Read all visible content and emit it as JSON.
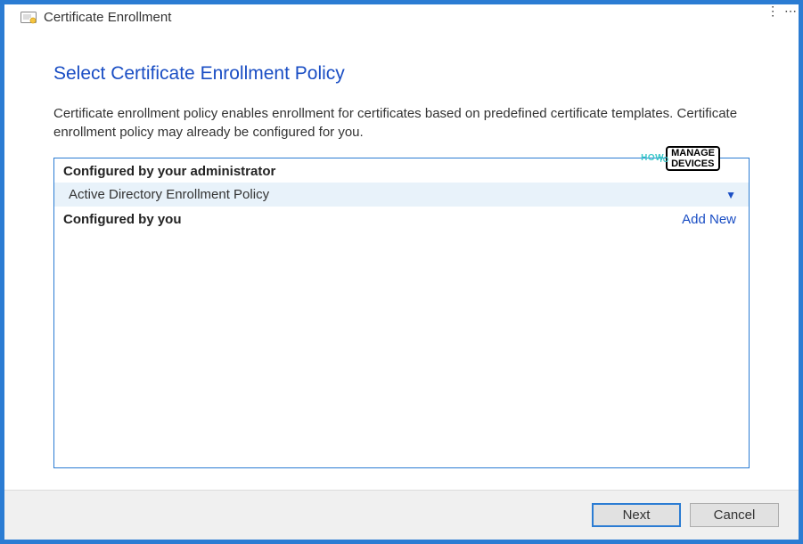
{
  "window": {
    "title": "Certificate Enrollment"
  },
  "page": {
    "heading": "Select Certificate Enrollment Policy",
    "description": "Certificate enrollment policy enables enrollment for certificates based on predefined certificate templates. Certificate enrollment policy may already be configured for you."
  },
  "sections": {
    "admin": {
      "title": "Configured by your administrator",
      "policy": "Active Directory Enrollment Policy"
    },
    "user": {
      "title": "Configured by you",
      "add_label": "Add New"
    }
  },
  "buttons": {
    "next": "Next",
    "cancel": "Cancel"
  },
  "watermark": {
    "how": "HOW",
    "to": "TO",
    "manage": "MANAGE",
    "devices": "DEVICES"
  }
}
